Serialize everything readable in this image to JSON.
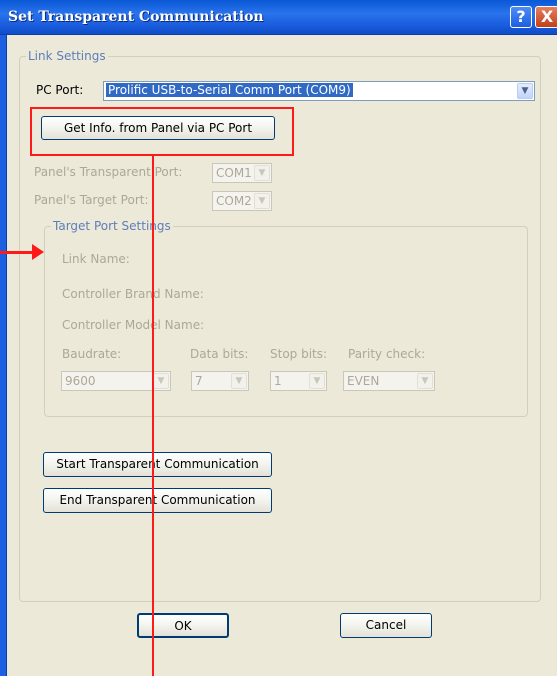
{
  "window": {
    "title": "Set Transparent Communication",
    "help_glyph": "?",
    "close_glyph": "X"
  },
  "link_settings": {
    "legend": "Link Settings",
    "pc_port_label": "PC Port:",
    "pc_port_value": "Prolific USB-to-Serial Comm Port (COM9)",
    "get_info_button": "Get Info. from Panel via PC Port",
    "transparent_port_label": "Panel's Transparent Port:",
    "transparent_port_value": "COM1",
    "target_port_label": "Panel's Target Port:",
    "target_port_value": "COM2"
  },
  "target_port_settings": {
    "legend": "Target Port Settings",
    "link_name_label": "Link Name:",
    "controller_brand_label": "Controller Brand Name:",
    "controller_model_label": "Controller Model Name:",
    "baudrate_label": "Baudrate:",
    "baudrate_value": "9600",
    "data_bits_label": "Data bits:",
    "data_bits_value": "7",
    "stop_bits_label": "Stop bits:",
    "stop_bits_value": "1",
    "parity_label": "Parity check:",
    "parity_value": "EVEN"
  },
  "actions": {
    "start_button": "Start Transparent Communication",
    "end_button": "End Transparent Communication"
  },
  "footer": {
    "ok_button": "OK",
    "cancel_button": "Cancel"
  },
  "colors": {
    "annotation": "#ff1a1a",
    "title_bar": "#1c5fe0",
    "dialog_face": "#ece9d8",
    "legend_blue": "#0046d5"
  },
  "icons": {
    "dropdown": "chevron-down-icon",
    "help": "help-icon",
    "close": "close-icon",
    "annotation_arrow": "arrow-right-icon"
  }
}
